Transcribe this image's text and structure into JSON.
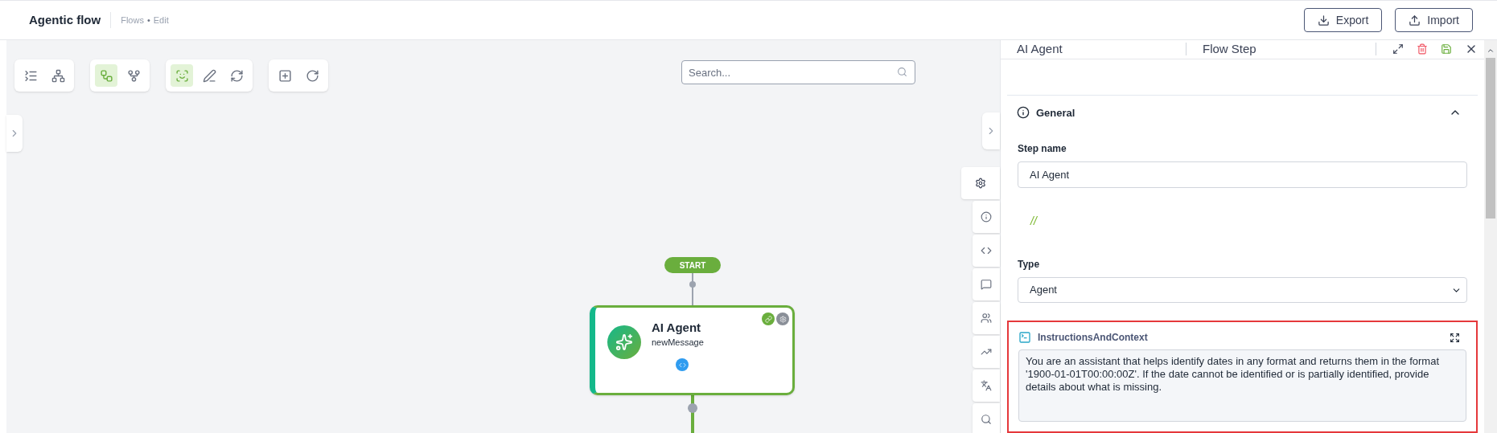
{
  "header": {
    "title": "Agentic flow",
    "breadcrumb": [
      "Flows",
      "Edit"
    ],
    "breadcrumb_separator": "•",
    "buttons": [
      {
        "kind": "export",
        "label": "Export"
      },
      {
        "kind": "import",
        "label": "Import"
      }
    ]
  },
  "toolbar": [
    [
      {
        "kind": "collapse",
        "selected": false
      },
      {
        "kind": "network",
        "selected": false
      }
    ],
    [
      {
        "kind": "tree",
        "selected": true
      },
      {
        "kind": "branch",
        "selected": false
      }
    ],
    [
      {
        "kind": "focus",
        "selected": true
      },
      {
        "kind": "edit",
        "selected": false
      },
      {
        "kind": "refresh",
        "selected": false
      }
    ],
    [
      {
        "kind": "add",
        "selected": false
      },
      {
        "kind": "loop",
        "selected": false
      }
    ]
  ],
  "search": {
    "placeholder": "Search..."
  },
  "canvas": {
    "start_label": "START",
    "node": {
      "title": "AI Agent",
      "subtitle": "newMessage"
    }
  },
  "side_tabs": [
    {
      "kind": "settings",
      "selected": true
    },
    {
      "kind": "info",
      "selected": false
    },
    {
      "kind": "code",
      "selected": false
    },
    {
      "kind": "chat",
      "selected": false
    },
    {
      "kind": "team",
      "selected": false
    },
    {
      "kind": "chart",
      "selected": false
    },
    {
      "kind": "translate",
      "selected": false
    },
    {
      "kind": "search",
      "selected": false
    }
  ],
  "panel": {
    "title": "AI Agent",
    "subtitle": "Flow Step",
    "section": {
      "title": "General",
      "expanded": true
    },
    "step_name": {
      "label": "Step name",
      "value": "AI Agent"
    },
    "comment": "//",
    "type": {
      "label": "Type",
      "value": "Agent"
    },
    "instructions": {
      "label": "InstructionsAndContext",
      "value": "You are an assistant that helps identify dates in any format and returns them in the format '1900-01-01T00:00:00Z'. If the date cannot be identified or is partially identified, provide details about what is missing."
    }
  }
}
